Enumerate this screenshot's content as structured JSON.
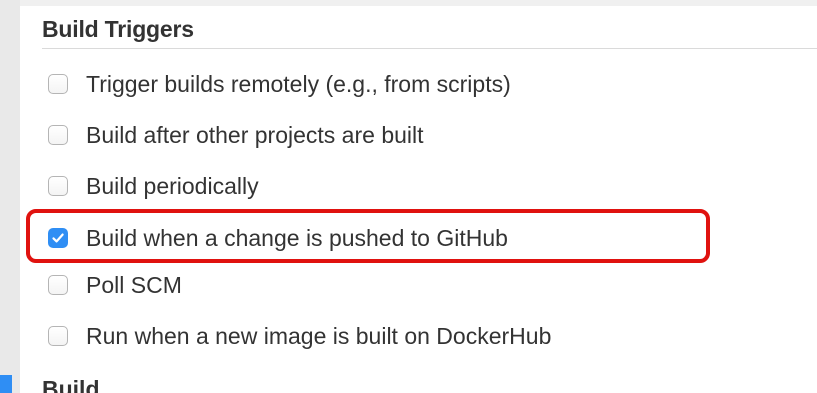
{
  "section": {
    "title": "Build Triggers"
  },
  "triggers": [
    {
      "label": "Trigger builds remotely (e.g., from scripts)",
      "checked": false
    },
    {
      "label": "Build after other projects are built",
      "checked": false
    },
    {
      "label": "Build periodically",
      "checked": false
    },
    {
      "label": "Build when a change is pushed to GitHub",
      "checked": true
    },
    {
      "label": "Poll SCM",
      "checked": false
    },
    {
      "label": "Run when a new image is built on DockerHub",
      "checked": false
    }
  ],
  "next_section": {
    "title": "Build"
  },
  "colors": {
    "checkbox_checked": "#2f8ef4",
    "highlight_border": "#e0120f",
    "text": "#333333"
  },
  "icons": {
    "checked_mark": "checkmark-icon"
  }
}
